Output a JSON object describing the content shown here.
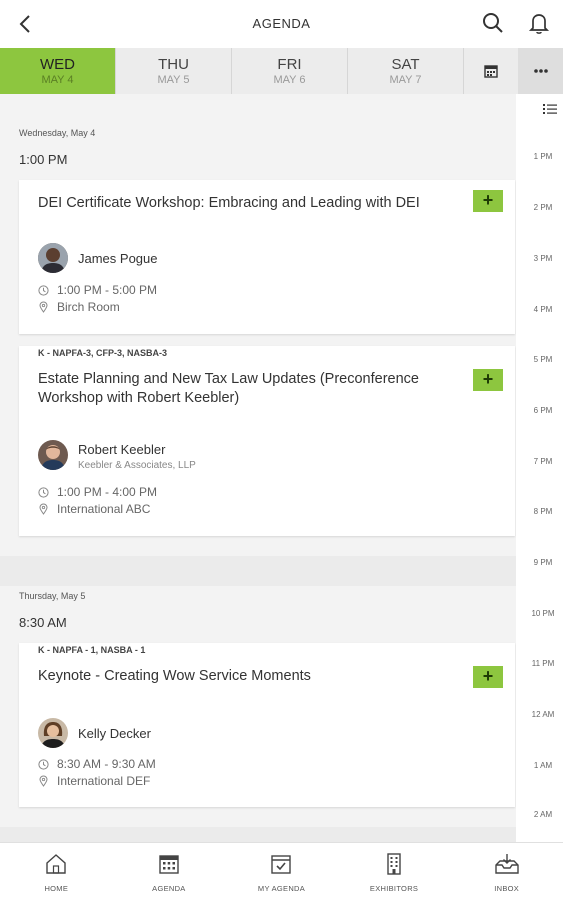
{
  "header": {
    "title": "AGENDA"
  },
  "days": [
    {
      "name": "WED",
      "date": "MAY 4",
      "active": true
    },
    {
      "name": "THU",
      "date": "MAY 5",
      "active": false
    },
    {
      "name": "FRI",
      "date": "MAY 6",
      "active": false
    },
    {
      "name": "SAT",
      "date": "MAY 7",
      "active": false
    }
  ],
  "sections": [
    {
      "day_label": "Wednesday, May 4",
      "time_label": "1:00 PM",
      "sessions": [
        {
          "credits": "",
          "title": "DEI Certificate Workshop: Embracing and Leading with DEI",
          "speaker": "James Pogue",
          "org": "",
          "time": "1:00 PM - 5:00 PM",
          "location": "Birch Room"
        },
        {
          "credits": "K - NAPFA-3, CFP-3, NASBA-3",
          "title": "Estate Planning and New Tax Law Updates (Preconference Workshop with Robert Keebler)",
          "speaker": "Robert Keebler",
          "org": "Keebler & Associates, LLP",
          "time": "1:00 PM - 4:00 PM",
          "location": "International ABC"
        }
      ]
    },
    {
      "day_label": "Thursday, May 5",
      "time_label": "8:30 AM",
      "sessions": [
        {
          "credits": "K - NAPFA - 1, NASBA - 1",
          "title": "Keynote - Creating Wow Service Moments",
          "speaker": "Kelly Decker",
          "org": "",
          "time": "8:30 AM - 9:30 AM",
          "location": "International DEF"
        }
      ]
    }
  ],
  "add_label": "+",
  "timeline": [
    "1 PM",
    "2 PM",
    "3 PM",
    "4 PM",
    "5 PM",
    "6 PM",
    "7 PM",
    "8 PM",
    "9 PM",
    "10 PM",
    "11 PM",
    "12 AM",
    "1 AM",
    "2 AM"
  ],
  "nav": [
    {
      "label": "HOME",
      "icon": "home-icon"
    },
    {
      "label": "AGENDA",
      "icon": "calendar-icon"
    },
    {
      "label": "MY AGENDA",
      "icon": "calendar-check-icon"
    },
    {
      "label": "EXHIBITORS",
      "icon": "building-icon"
    },
    {
      "label": "INBOX",
      "icon": "inbox-icon"
    }
  ],
  "colors": {
    "accent": "#8dc63f",
    "background": "#f3f3f3"
  }
}
